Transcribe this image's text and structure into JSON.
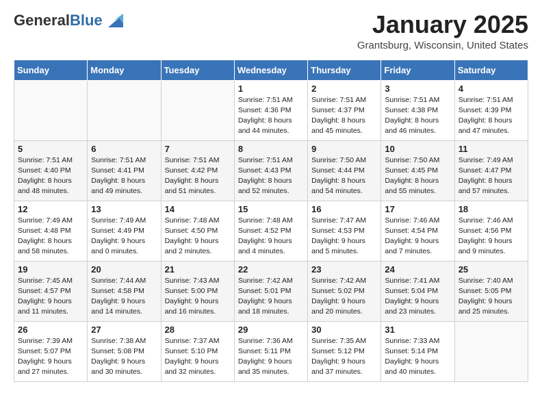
{
  "header": {
    "logo_general": "General",
    "logo_blue": "Blue",
    "month_title": "January 2025",
    "location": "Grantsburg, Wisconsin, United States"
  },
  "columns": [
    "Sunday",
    "Monday",
    "Tuesday",
    "Wednesday",
    "Thursday",
    "Friday",
    "Saturday"
  ],
  "weeks": [
    {
      "days": [
        {
          "num": "",
          "text": ""
        },
        {
          "num": "",
          "text": ""
        },
        {
          "num": "",
          "text": ""
        },
        {
          "num": "1",
          "text": "Sunrise: 7:51 AM\nSunset: 4:36 PM\nDaylight: 8 hours\nand 44 minutes."
        },
        {
          "num": "2",
          "text": "Sunrise: 7:51 AM\nSunset: 4:37 PM\nDaylight: 8 hours\nand 45 minutes."
        },
        {
          "num": "3",
          "text": "Sunrise: 7:51 AM\nSunset: 4:38 PM\nDaylight: 8 hours\nand 46 minutes."
        },
        {
          "num": "4",
          "text": "Sunrise: 7:51 AM\nSunset: 4:39 PM\nDaylight: 8 hours\nand 47 minutes."
        }
      ]
    },
    {
      "days": [
        {
          "num": "5",
          "text": "Sunrise: 7:51 AM\nSunset: 4:40 PM\nDaylight: 8 hours\nand 48 minutes."
        },
        {
          "num": "6",
          "text": "Sunrise: 7:51 AM\nSunset: 4:41 PM\nDaylight: 8 hours\nand 49 minutes."
        },
        {
          "num": "7",
          "text": "Sunrise: 7:51 AM\nSunset: 4:42 PM\nDaylight: 8 hours\nand 51 minutes."
        },
        {
          "num": "8",
          "text": "Sunrise: 7:51 AM\nSunset: 4:43 PM\nDaylight: 8 hours\nand 52 minutes."
        },
        {
          "num": "9",
          "text": "Sunrise: 7:50 AM\nSunset: 4:44 PM\nDaylight: 8 hours\nand 54 minutes."
        },
        {
          "num": "10",
          "text": "Sunrise: 7:50 AM\nSunset: 4:45 PM\nDaylight: 8 hours\nand 55 minutes."
        },
        {
          "num": "11",
          "text": "Sunrise: 7:49 AM\nSunset: 4:47 PM\nDaylight: 8 hours\nand 57 minutes."
        }
      ]
    },
    {
      "days": [
        {
          "num": "12",
          "text": "Sunrise: 7:49 AM\nSunset: 4:48 PM\nDaylight: 8 hours\nand 58 minutes."
        },
        {
          "num": "13",
          "text": "Sunrise: 7:49 AM\nSunset: 4:49 PM\nDaylight: 9 hours\nand 0 minutes."
        },
        {
          "num": "14",
          "text": "Sunrise: 7:48 AM\nSunset: 4:50 PM\nDaylight: 9 hours\nand 2 minutes."
        },
        {
          "num": "15",
          "text": "Sunrise: 7:48 AM\nSunset: 4:52 PM\nDaylight: 9 hours\nand 4 minutes."
        },
        {
          "num": "16",
          "text": "Sunrise: 7:47 AM\nSunset: 4:53 PM\nDaylight: 9 hours\nand 5 minutes."
        },
        {
          "num": "17",
          "text": "Sunrise: 7:46 AM\nSunset: 4:54 PM\nDaylight: 9 hours\nand 7 minutes."
        },
        {
          "num": "18",
          "text": "Sunrise: 7:46 AM\nSunset: 4:56 PM\nDaylight: 9 hours\nand 9 minutes."
        }
      ]
    },
    {
      "days": [
        {
          "num": "19",
          "text": "Sunrise: 7:45 AM\nSunset: 4:57 PM\nDaylight: 9 hours\nand 11 minutes."
        },
        {
          "num": "20",
          "text": "Sunrise: 7:44 AM\nSunset: 4:58 PM\nDaylight: 9 hours\nand 14 minutes."
        },
        {
          "num": "21",
          "text": "Sunrise: 7:43 AM\nSunset: 5:00 PM\nDaylight: 9 hours\nand 16 minutes."
        },
        {
          "num": "22",
          "text": "Sunrise: 7:42 AM\nSunset: 5:01 PM\nDaylight: 9 hours\nand 18 minutes."
        },
        {
          "num": "23",
          "text": "Sunrise: 7:42 AM\nSunset: 5:02 PM\nDaylight: 9 hours\nand 20 minutes."
        },
        {
          "num": "24",
          "text": "Sunrise: 7:41 AM\nSunset: 5:04 PM\nDaylight: 9 hours\nand 23 minutes."
        },
        {
          "num": "25",
          "text": "Sunrise: 7:40 AM\nSunset: 5:05 PM\nDaylight: 9 hours\nand 25 minutes."
        }
      ]
    },
    {
      "days": [
        {
          "num": "26",
          "text": "Sunrise: 7:39 AM\nSunset: 5:07 PM\nDaylight: 9 hours\nand 27 minutes."
        },
        {
          "num": "27",
          "text": "Sunrise: 7:38 AM\nSunset: 5:08 PM\nDaylight: 9 hours\nand 30 minutes."
        },
        {
          "num": "28",
          "text": "Sunrise: 7:37 AM\nSunset: 5:10 PM\nDaylight: 9 hours\nand 32 minutes."
        },
        {
          "num": "29",
          "text": "Sunrise: 7:36 AM\nSunset: 5:11 PM\nDaylight: 9 hours\nand 35 minutes."
        },
        {
          "num": "30",
          "text": "Sunrise: 7:35 AM\nSunset: 5:12 PM\nDaylight: 9 hours\nand 37 minutes."
        },
        {
          "num": "31",
          "text": "Sunrise: 7:33 AM\nSunset: 5:14 PM\nDaylight: 9 hours\nand 40 minutes."
        },
        {
          "num": "",
          "text": ""
        }
      ]
    }
  ]
}
